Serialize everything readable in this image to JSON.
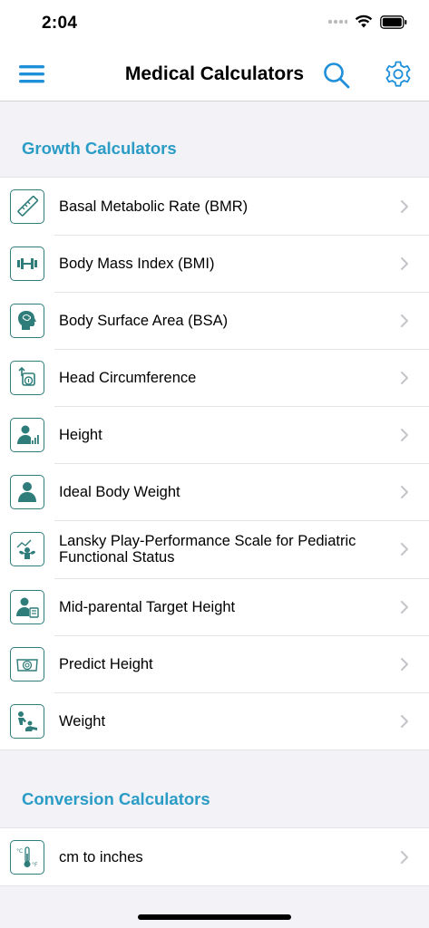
{
  "status_bar": {
    "time": "2:04"
  },
  "nav": {
    "title": "Medical Calculators"
  },
  "sections": [
    {
      "title": "Growth Calculators",
      "items": [
        {
          "label": "Basal Metabolic Rate (BMR)",
          "icon": "ruler-icon"
        },
        {
          "label": "Body Mass Index (BMI)",
          "icon": "dumbbell-icon"
        },
        {
          "label": "Body Surface Area (BSA)",
          "icon": "head-brain-icon"
        },
        {
          "label": "Head Circumference",
          "icon": "head-measure-icon"
        },
        {
          "label": "Height",
          "icon": "person-height-icon"
        },
        {
          "label": "Ideal Body Weight",
          "icon": "person-icon"
        },
        {
          "label": "Lansky Play-Performance Scale for Pediatric Functional Status",
          "icon": "strength-chart-icon"
        },
        {
          "label": "Mid-parental Target Height",
          "icon": "person-calculator-icon"
        },
        {
          "label": "Predict Height",
          "icon": "scale-dial-icon"
        },
        {
          "label": "Weight",
          "icon": "baby-crawl-icon"
        }
      ]
    },
    {
      "title": "Conversion Calculators",
      "items": [
        {
          "label": "cm to inches",
          "icon": "thermometer-icon"
        }
      ]
    }
  ],
  "colors": {
    "accent": "#2a9cc5",
    "nav_icon": "#1e8fd8",
    "icon_teal": "#2e7d7a"
  }
}
